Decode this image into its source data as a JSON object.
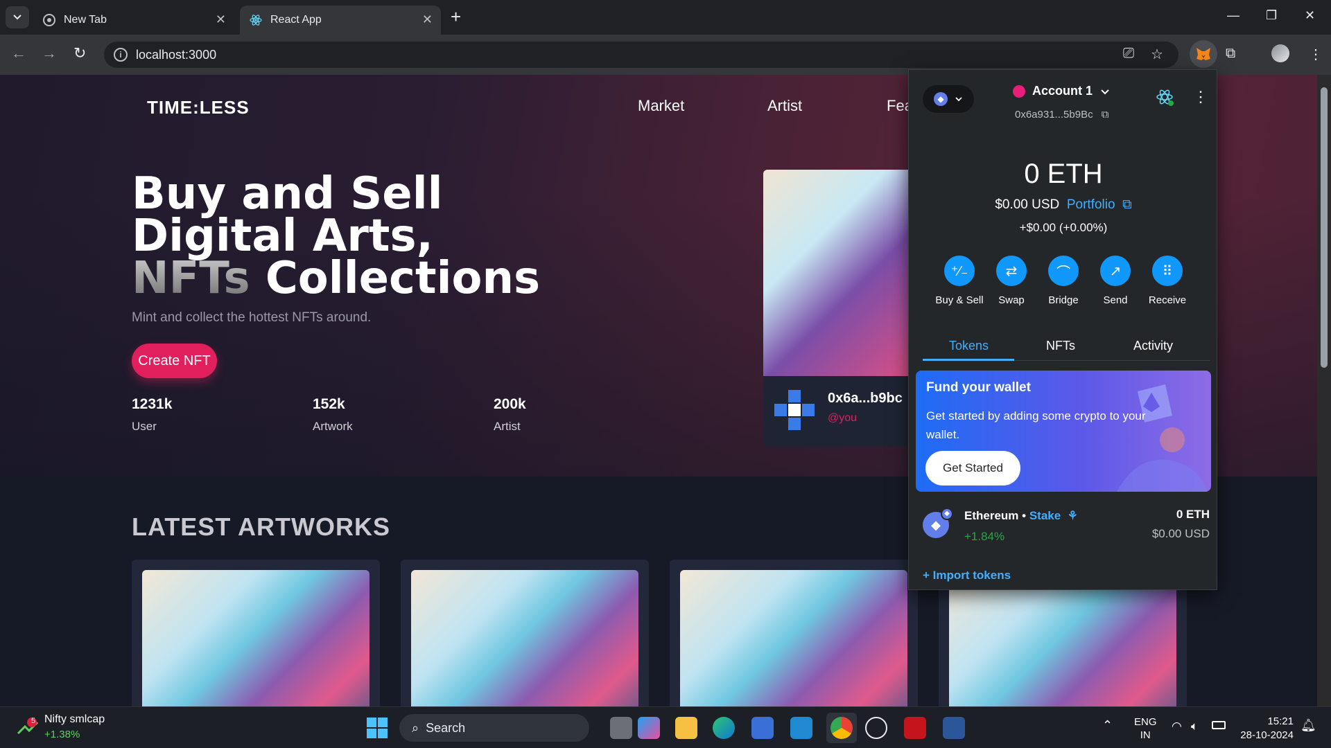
{
  "browser": {
    "tabs": [
      {
        "title": "New Tab",
        "icon": "chrome-icon",
        "active": false
      },
      {
        "title": "React App",
        "icon": "react-icon",
        "active": true
      }
    ],
    "url": "localhost:3000"
  },
  "site": {
    "logo": "TIME:LESS",
    "nav": [
      "Market",
      "Artist",
      "Fea"
    ],
    "hero": {
      "line1": "Buy and Sell",
      "line2": "Digital Arts,",
      "line3_grey": "NFTs",
      "line3_rest": " Collections",
      "subtitle": "Mint and collect the hottest NFTs around.",
      "cta": "Create NFT"
    },
    "stats": [
      {
        "value": "1231k",
        "label": "User"
      },
      {
        "value": "152k",
        "label": "Artwork"
      },
      {
        "value": "200k",
        "label": "Artist"
      }
    ],
    "featured": {
      "address": "0x6a...b9bc",
      "handle": "@you"
    },
    "latest_title": "LATEST ARTWORKS"
  },
  "metamask": {
    "account": "Account 1",
    "address": "0x6a931...5b9Bc",
    "balance": "0 ETH",
    "usd": "$0.00 USD",
    "portfolio": "Portfolio",
    "change": "+$0.00 (+0.00%)",
    "actions": [
      "Buy & Sell",
      "Swap",
      "Bridge",
      "Send",
      "Receive"
    ],
    "tabs": [
      "Tokens",
      "NFTs",
      "Activity"
    ],
    "fund": {
      "title": "Fund your wallet",
      "desc": "Get started by adding some crypto to your wallet.",
      "button": "Get Started"
    },
    "token": {
      "name": "Ethereum",
      "sep": " • ",
      "stake": "Stake",
      "pct": "+1.84%",
      "amount": "0 ETH",
      "usd": "$0.00 USD"
    },
    "import": "Import tokens",
    "colors": {
      "accent": "#43aefc",
      "button": "#1098fc",
      "positive": "#28a745"
    }
  },
  "taskbar": {
    "widget_title": "Nifty smlcap",
    "widget_value": "+1.38%",
    "widget_badge": "5",
    "search": "Search",
    "lang1": "ENG",
    "lang2": "IN",
    "time": "15:21",
    "date": "28-10-2024"
  }
}
